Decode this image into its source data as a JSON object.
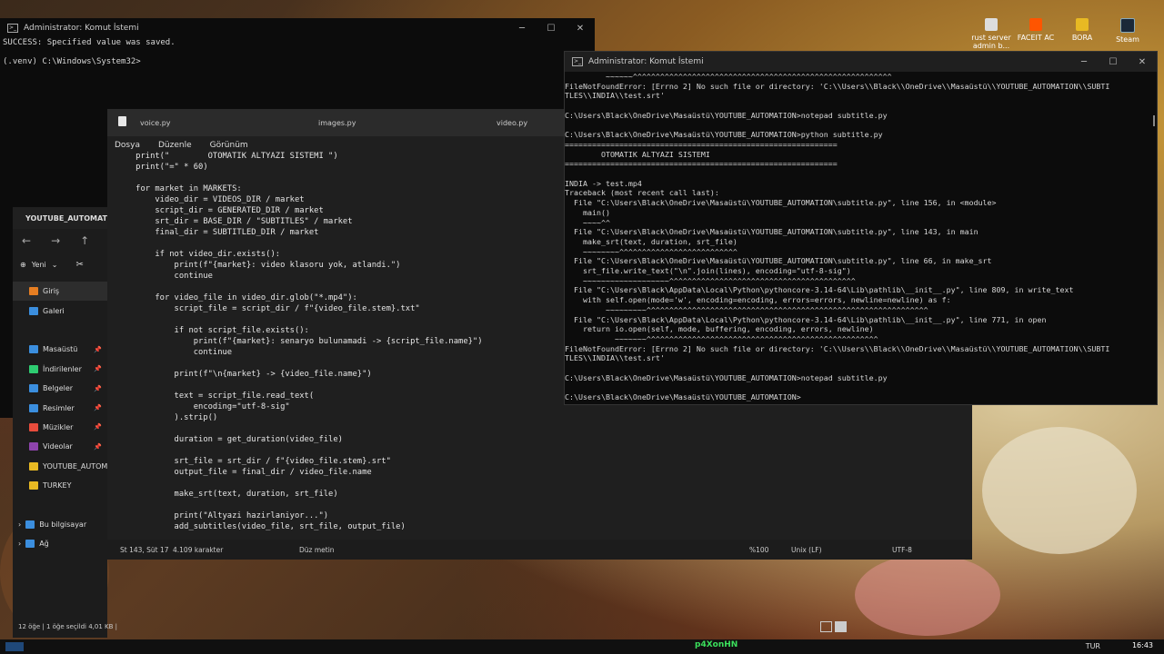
{
  "desktop_icons": [
    {
      "label": "rust server admin b..."
    },
    {
      "label": "FACEIT AC"
    },
    {
      "label": "BORA"
    },
    {
      "label": "Steam"
    }
  ],
  "cmd_back": {
    "title": "Administrator: Komut İstemi",
    "text": "SUCCESS: Specified value was saved.\n\n(.venv) C:\\Windows\\System32>"
  },
  "explorer": {
    "tab_title": "YOUTUBE_AUTOMATION",
    "new_label": "Yeni",
    "items": [
      {
        "label": "Giriş",
        "color": "#e67e22"
      },
      {
        "label": "Galeri",
        "color": "#3b8ede"
      },
      {
        "label": "",
        "color": ""
      },
      {
        "label": "Masaüstü",
        "color": "#3b8ede"
      },
      {
        "label": "İndirilenler",
        "color": "#2ecc71"
      },
      {
        "label": "Belgeler",
        "color": "#3b8ede"
      },
      {
        "label": "Resimler",
        "color": "#3b8ede"
      },
      {
        "label": "Müzikler",
        "color": "#e74c3c"
      },
      {
        "label": "Videolar",
        "color": "#8e44ad"
      },
      {
        "label": "YOUTUBE_AUTOMATION",
        "color": "#e8b923"
      },
      {
        "label": "TURKEY",
        "color": "#e8b923"
      },
      {
        "label": "",
        "color": ""
      },
      {
        "label": "Bu bilgisayar",
        "color": "#3b8ede"
      },
      {
        "label": "Ağ",
        "color": "#3b8ede"
      }
    ],
    "status": "12 öğe  |  1 öğe seçildi 4,01 KB  |"
  },
  "notepad": {
    "tabs": [
      "voice.py",
      "images.py",
      "video.py"
    ],
    "menu": [
      "Dosya",
      "Düzenle",
      "Görünüm"
    ],
    "code": "    print(\"        OTOMATIK ALTYAZI SISTEMI \")\n    print(\"=\" * 60)\n\n    for market in MARKETS:\n        video_dir = VIDEOS_DIR / market\n        script_dir = GENERATED_DIR / market\n        srt_dir = BASE_DIR / \"SUBTITLES\" / market\n        final_dir = SUBTITLED_DIR / market\n\n        if not video_dir.exists():\n            print(f\"{market}: video klasoru yok, atlandi.\")\n            continue\n\n        for video_file in video_dir.glob(\"*.mp4\"):\n            script_file = script_dir / f\"{video_file.stem}.txt\"\n\n            if not script_file.exists():\n                print(f\"{market}: senaryo bulunamadi -> {script_file.name}\")\n                continue\n\n            print(f\"\\n{market} -> {video_file.name}\")\n\n            text = script_file.read_text(\n                encoding=\"utf-8-sig\"\n            ).strip()\n\n            duration = get_duration(video_file)\n\n            srt_file = srt_dir / f\"{video_file.stem}.srt\"\n            output_file = final_dir / video_file.name\n\n            make_srt(text, duration, srt_file)\n\n            print(\"Altyazi hazirlaniyor...\")\n            add_subtitles(video_file, srt_file, output_file)",
    "status": {
      "position": "St 143, Süt 17",
      "chars": "4.109 karakter",
      "mode": "Düz metin",
      "zoom": "%100",
      "eol": "Unix (LF)",
      "encoding": "UTF-8"
    }
  },
  "cmd_front": {
    "title": "Administrator: Komut İstemi",
    "text": "         ~~~~~~^^^^^^^^^^^^^^^^^^^^^^^^^^^^^^^^^^^^^^^^^^^^^^^^^^^^^^^^^\nFileNotFoundError: [Errno 2] No such file or directory: 'C:\\\\Users\\\\Black\\\\OneDrive\\\\Masaüstü\\\\YOUTUBE_AUTOMATION\\\\SUBTI\nTLES\\\\INDIA\\\\test.srt'\n\nC:\\Users\\Black\\OneDrive\\Masaüstü\\YOUTUBE_AUTOMATION>notepad subtitle.py\n\nC:\\Users\\Black\\OneDrive\\Masaüstü\\YOUTUBE_AUTOMATION>python subtitle.py\n============================================================\n        OTOMATIK ALTYAZI SISTEMI\n============================================================\n\nINDIA -> test.mp4\nTraceback (most recent call last):\n  File \"C:\\Users\\Black\\OneDrive\\Masaüstü\\YOUTUBE_AUTOMATION\\subtitle.py\", line 156, in <module>\n    main()\n    ~~~~^^\n  File \"C:\\Users\\Black\\OneDrive\\Masaüstü\\YOUTUBE_AUTOMATION\\subtitle.py\", line 143, in main\n    make_srt(text, duration, srt_file)\n    ~~~~~~~~^^^^^^^^^^^^^^^^^^^^^^^^^^\n  File \"C:\\Users\\Black\\OneDrive\\Masaüstü\\YOUTUBE_AUTOMATION\\subtitle.py\", line 66, in make_srt\n    srt_file.write_text(\"\\n\".join(lines), encoding=\"utf-8-sig\")\n    ~~~~~~~~~~~~~~~~~~~^^^^^^^^^^^^^^^^^^^^^^^^^^^^^^^^^^^^^^^^^\n  File \"C:\\Users\\Black\\AppData\\Local\\Python\\pythoncore-3.14-64\\Lib\\pathlib\\__init__.py\", line 809, in write_text\n    with self.open(mode='w', encoding=encoding, errors=errors, newline=newline) as f:\n         ~~~~~~~~~^^^^^^^^^^^^^^^^^^^^^^^^^^^^^^^^^^^^^^^^^^^^^^^^^^^^^^^^^^^^^^\n  File \"C:\\Users\\Black\\AppData\\Local\\Python\\pythoncore-3.14-64\\Lib\\pathlib\\__init__.py\", line 771, in open\n    return io.open(self, mode, buffering, encoding, errors, newline)\n           ~~~~~~~^^^^^^^^^^^^^^^^^^^^^^^^^^^^^^^^^^^^^^^^^^^^^^^^^^^\nFileNotFoundError: [Errno 2] No such file or directory: 'C:\\\\Users\\\\Black\\\\OneDrive\\\\Masaüstü\\\\YOUTUBE_AUTOMATION\\\\SUBTI\nTLES\\\\INDIA\\\\test.srt'\n\nC:\\Users\\Black\\OneDrive\\Masaüstü\\YOUTUBE_AUTOMATION>notepad subtitle.py\n\nC:\\Users\\Black\\OneDrive\\Masaüstü\\YOUTUBE_AUTOMATION>"
  },
  "taskbar": {
    "username": "p4XonHN",
    "time": "16:43",
    "tray": "TUR"
  }
}
